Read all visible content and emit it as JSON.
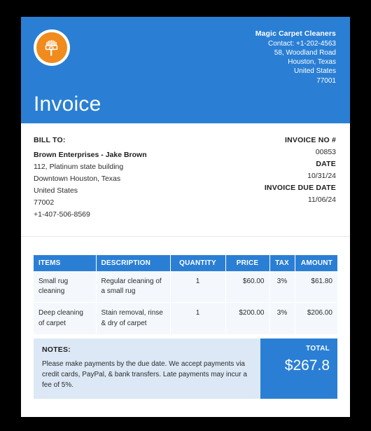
{
  "header": {
    "logo_icon": "carpet-cleaner-brush-icon",
    "title": "Invoice",
    "company": {
      "name": "Magic Carpet Cleaners",
      "contact": "Contact: +1-202-4563",
      "address_line1": "58, Woodland Road",
      "address_line2": "Houston, Texas",
      "country": "United States",
      "zip": "77001"
    },
    "accent_color": "#2a7fd4",
    "logo_color": "#f08b1d"
  },
  "bill_to": {
    "label": "BILL TO:",
    "name": "Brown Enterprises - Jake Brown",
    "address_line1": "112, Platinum state building",
    "address_line2": "Downtown Houston, Texas",
    "country": "United States",
    "zip": "77002",
    "phone": "+1-407-506-8569"
  },
  "meta": {
    "invoice_no_label": "INVOICE NO #",
    "invoice_no": "00853",
    "date_label": "DATE",
    "date": "10/31/24",
    "due_date_label": "INVOICE DUE DATE",
    "due_date": "11/06/24"
  },
  "table": {
    "columns": [
      "ITEMS",
      "DESCRIPTION",
      "QUANTITY",
      "PRICE",
      "TAX",
      "AMOUNT"
    ],
    "rows": [
      {
        "item": "Small rug cleaning",
        "description": "Regular cleaning of a small rug",
        "quantity": "1",
        "price": "$60.00",
        "tax": "3%",
        "amount": "$61.80"
      },
      {
        "item": "Deep cleaning of carpet",
        "description": "Stain removal, rinse & dry of carpet",
        "quantity": "1",
        "price": "$200.00",
        "tax": "3%",
        "amount": "$206.00"
      }
    ]
  },
  "notes": {
    "label": "NOTES:",
    "text": "Please make payments by the due date. We accept payments via credit cards, PayPal, & bank transfers. Late payments may incur a fee of 5%."
  },
  "total": {
    "label": "TOTAL",
    "value": "$267.8"
  }
}
